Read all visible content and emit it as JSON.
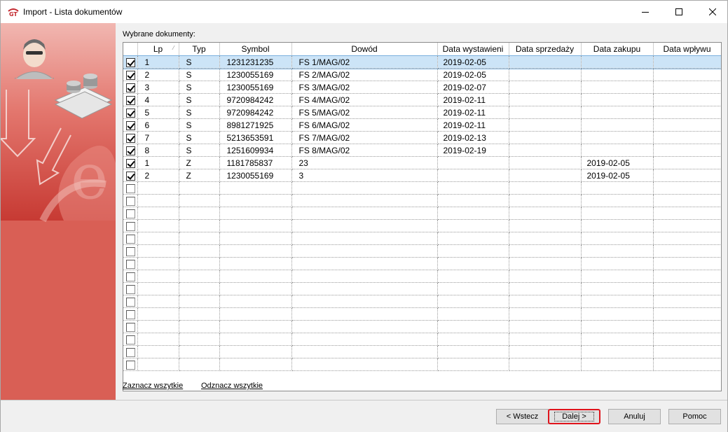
{
  "window": {
    "title": "Import - Lista dokumentów"
  },
  "panel": {
    "label": "Wybrane dokumenty:"
  },
  "columns": {
    "lp": "Lp",
    "typ": "Typ",
    "symbol": "Symbol",
    "dowod": "Dowód",
    "data_wystawienia": "Data wystawieni",
    "data_sprzedazy": "Data sprzedaży",
    "data_zakupu": "Data zakupu",
    "data_wplywu": "Data wpływu"
  },
  "rows": [
    {
      "checked": true,
      "lp": "1",
      "typ": "S",
      "symbol": "1231231235",
      "dowod": "FS 1/MAG/02",
      "data_wystawienia": "2019-02-05",
      "data_sprzedazy": "",
      "data_zakupu": "",
      "data_wplywu": ""
    },
    {
      "checked": true,
      "lp": "2",
      "typ": "S",
      "symbol": "1230055169",
      "dowod": "FS 2/MAG/02",
      "data_wystawienia": "2019-02-05",
      "data_sprzedazy": "",
      "data_zakupu": "",
      "data_wplywu": ""
    },
    {
      "checked": true,
      "lp": "3",
      "typ": "S",
      "symbol": "1230055169",
      "dowod": "FS 3/MAG/02",
      "data_wystawienia": "2019-02-07",
      "data_sprzedazy": "",
      "data_zakupu": "",
      "data_wplywu": ""
    },
    {
      "checked": true,
      "lp": "4",
      "typ": "S",
      "symbol": "9720984242",
      "dowod": "FS 4/MAG/02",
      "data_wystawienia": "2019-02-11",
      "data_sprzedazy": "",
      "data_zakupu": "",
      "data_wplywu": ""
    },
    {
      "checked": true,
      "lp": "5",
      "typ": "S",
      "symbol": "9720984242",
      "dowod": "FS 5/MAG/02",
      "data_wystawienia": "2019-02-11",
      "data_sprzedazy": "",
      "data_zakupu": "",
      "data_wplywu": ""
    },
    {
      "checked": true,
      "lp": "6",
      "typ": "S",
      "symbol": "8981271925",
      "dowod": "FS 6/MAG/02",
      "data_wystawienia": "2019-02-11",
      "data_sprzedazy": "",
      "data_zakupu": "",
      "data_wplywu": ""
    },
    {
      "checked": true,
      "lp": "7",
      "typ": "S",
      "symbol": "5213653591",
      "dowod": "FS 7/MAG/02",
      "data_wystawienia": "2019-02-13",
      "data_sprzedazy": "",
      "data_zakupu": "",
      "data_wplywu": ""
    },
    {
      "checked": true,
      "lp": "8",
      "typ": "S",
      "symbol": "1251609934",
      "dowod": "FS 8/MAG/02",
      "data_wystawienia": "2019-02-19",
      "data_sprzedazy": "",
      "data_zakupu": "",
      "data_wplywu": ""
    },
    {
      "checked": true,
      "lp": "1",
      "typ": "Z",
      "symbol": "1181785837",
      "dowod": "23",
      "data_wystawienia": "",
      "data_sprzedazy": "",
      "data_zakupu": "2019-02-05",
      "data_wplywu": ""
    },
    {
      "checked": true,
      "lp": "2",
      "typ": "Z",
      "symbol": "1230055169",
      "dowod": "3",
      "data_wystawienia": "",
      "data_sprzedazy": "",
      "data_zakupu": "2019-02-05",
      "data_wplywu": ""
    }
  ],
  "empty_row_count": 15,
  "links": {
    "select_all": "Zaznacz wszytkie",
    "deselect_all": "Odznacz wszytkie"
  },
  "buttons": {
    "back": "< Wstecz",
    "next": "Dalej >",
    "cancel": "Anuluj",
    "help": "Pomoc"
  },
  "colors": {
    "side_panel_red": "#d95f55",
    "selection": "#cce4f7",
    "focus_outline": "#e0141c"
  }
}
